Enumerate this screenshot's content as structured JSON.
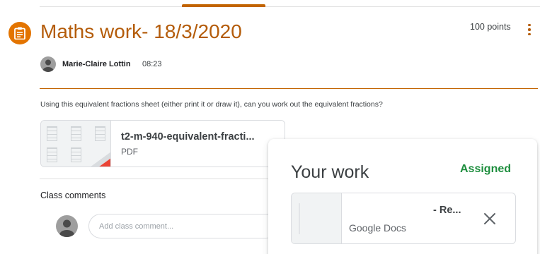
{
  "assignment": {
    "title": "Maths work- 18/3/2020",
    "points": "100 points",
    "author": "Marie-Claire Lottin",
    "posted_time": "08:23",
    "description": "Using this equivalent fractions sheet (either print it or draw it), can you work out the equivalent fractions?",
    "icon": "assignment-icon",
    "accent_color": "#b45c0a"
  },
  "attachment": {
    "name": "t2-m-940-equivalent-fracti...",
    "type": "PDF",
    "icon": "pdf-icon"
  },
  "comments": {
    "label": "Class comments",
    "placeholder": "Add class comment..."
  },
  "your_work": {
    "title": "Your work",
    "status": "Assigned",
    "status_color": "#1e8e3e",
    "file": {
      "name": "- Re...",
      "type": "Google Docs",
      "remove_icon": "close-icon"
    }
  }
}
